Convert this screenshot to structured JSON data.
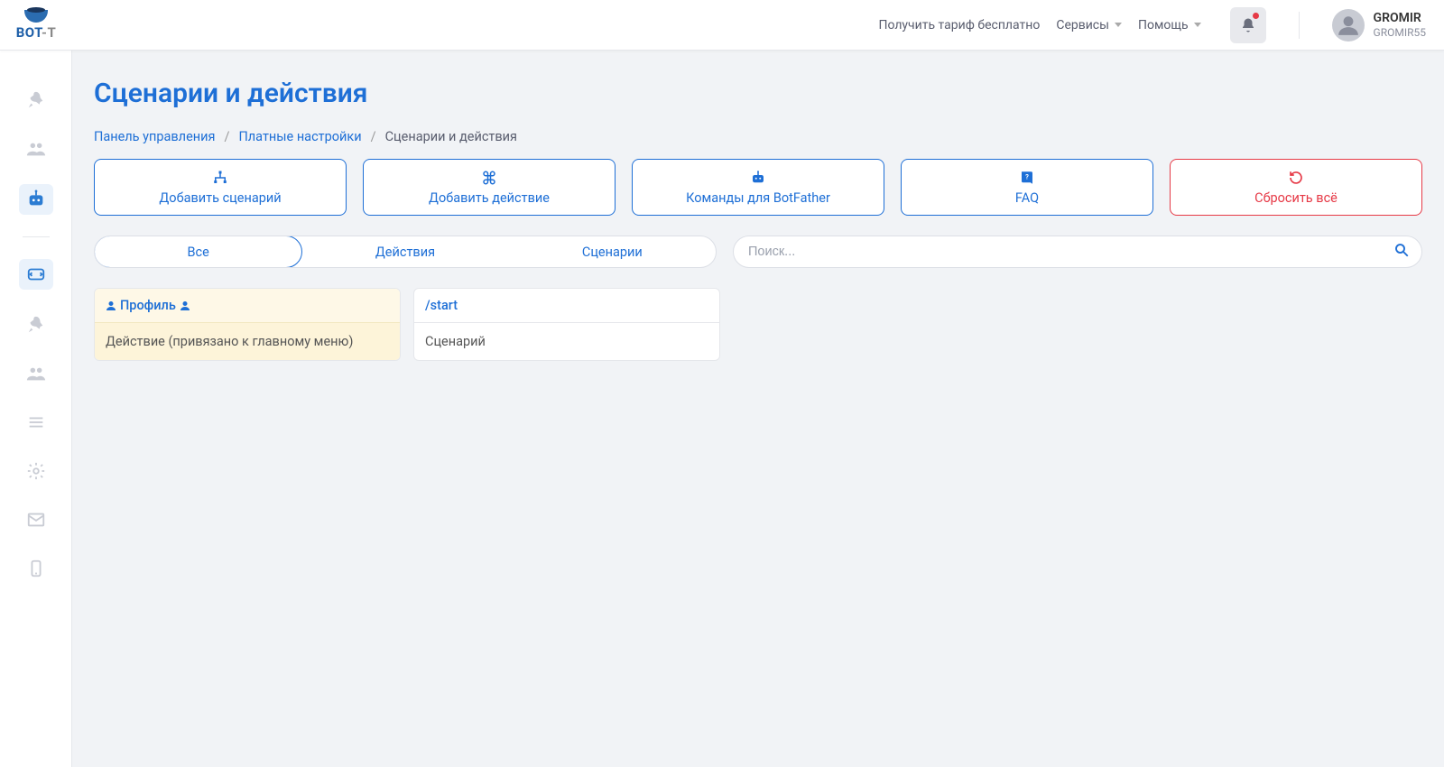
{
  "header": {
    "get_tariff": "Получить тариф бесплатно",
    "services": "Сервисы",
    "help": "Помощь",
    "user_name": "GROMIR",
    "user_handle": "GROMIR55"
  },
  "page": {
    "title": "Сценарии и действия"
  },
  "breadcrumb": {
    "dashboard": "Панель управления",
    "paid_settings": "Платные настройки",
    "current": "Сценарии и действия"
  },
  "actions": {
    "add_scenario": "Добавить сценарий",
    "add_action": "Добавить действие",
    "botfather": "Команды для BotFather",
    "faq": "FAQ",
    "reset": "Сбросить всё"
  },
  "tabs": {
    "all": "Все",
    "actions": "Действия",
    "scenarios": "Сценарии"
  },
  "search": {
    "placeholder": "Поиск..."
  },
  "cards": [
    {
      "title": " Профиль ",
      "subtitle": "Действие (привязано к главному меню)",
      "type": "action"
    },
    {
      "title": "/start",
      "subtitle": "Сценарий",
      "type": "scenario"
    }
  ]
}
